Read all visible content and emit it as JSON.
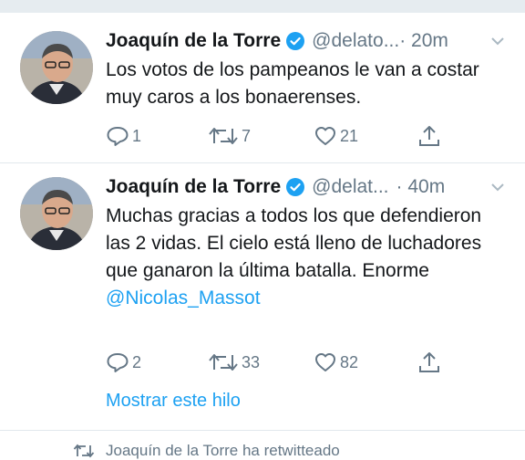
{
  "tweets": [
    {
      "name": "Joaquín de la Torre",
      "handle": "@delato...",
      "time": "· 20m",
      "text": "Los votos de los pampeanos le van a costar muy caros a los bonaerenses.",
      "replies": "1",
      "retweets": "7",
      "likes": "21"
    },
    {
      "name": "Joaquín de la Torre",
      "handle": "@delat...",
      "time": "· 40m",
      "text": "Muchas gracias a todos los que defendieron las 2 vidas. El cielo está lleno de luchadores que ganaron la última batalla. Enorme",
      "mention": "@Nicolas_Massot",
      "replies": "2",
      "retweets": "33",
      "likes": "82",
      "show_thread": "Mostrar este hilo"
    }
  ],
  "retweet_context": "Joaquín de la Torre ha retwitteado",
  "colors": {
    "accent": "#1da1f2",
    "muted": "#657786",
    "divider": "#e1e8ed"
  },
  "icons": [
    "verified-badge-icon",
    "chevron-down-icon",
    "reply-icon",
    "retweet-icon",
    "like-icon",
    "share-icon"
  ]
}
